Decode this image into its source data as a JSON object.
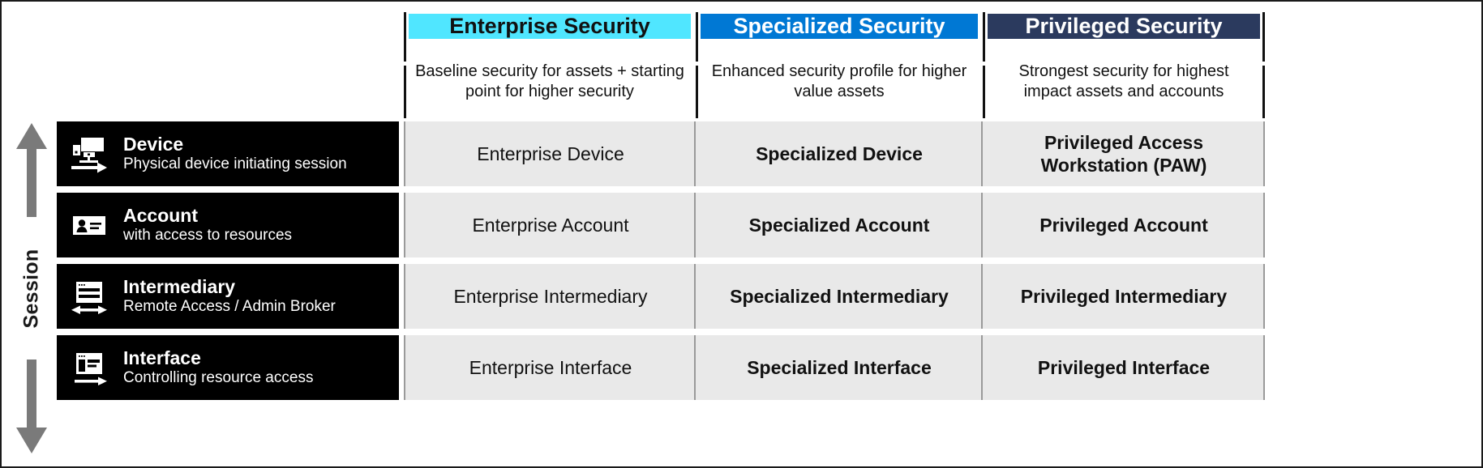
{
  "axis": {
    "label": "Session",
    "arrow_up_icon": "arrow-up-icon",
    "arrow_down_icon": "arrow-down-icon",
    "color": "#7a7a7a"
  },
  "columns": [
    {
      "id": "enterprise",
      "title": "Enterprise Security",
      "description": "Baseline security for assets + starting point for higher security",
      "header_bg": "#50E6FF",
      "header_text_color": "#111111",
      "bold_cells": false
    },
    {
      "id": "specialized",
      "title": "Specialized Security",
      "description": "Enhanced security profile for higher value assets",
      "header_bg": "#0078D4",
      "header_text_color": "#FFFFFF",
      "bold_cells": true
    },
    {
      "id": "privileged",
      "title": "Privileged Security",
      "description": "Strongest security for highest impact assets and accounts",
      "header_bg": "#2B3A5E",
      "header_text_color": "#FFFFFF",
      "bold_cells": true
    }
  ],
  "rows": [
    {
      "id": "device",
      "title": "Device",
      "subtitle": "Physical device initiating session",
      "icon": "device-monitor-arrow-icon",
      "values": [
        "Enterprise Device",
        "Specialized Device",
        "Privileged Access Workstation (PAW)"
      ]
    },
    {
      "id": "account",
      "title": "Account",
      "subtitle": "with access to resources",
      "icon": "account-id-card-icon",
      "values": [
        "Enterprise Account",
        "Specialized Account",
        "Privileged Account"
      ]
    },
    {
      "id": "intermediary",
      "title": "Intermediary",
      "subtitle": "Remote Access / Admin Broker",
      "icon": "intermediary-window-double-arrow-icon",
      "values": [
        "Enterprise Intermediary",
        "Specialized Intermediary",
        "Privileged Intermediary"
      ]
    },
    {
      "id": "interface",
      "title": "Interface",
      "subtitle": "Controlling resource access",
      "icon": "interface-window-arrow-icon",
      "values": [
        "Enterprise Interface",
        "Specialized Interface",
        "Privileged Interface"
      ]
    }
  ],
  "theme": {
    "row_label_bg": "#000000",
    "row_label_fg": "#FFFFFF",
    "cell_bg": "#E9E9E9",
    "cell_fg": "#111111",
    "page_bg": "#FFFFFF",
    "border": "#1A1A1A"
  }
}
